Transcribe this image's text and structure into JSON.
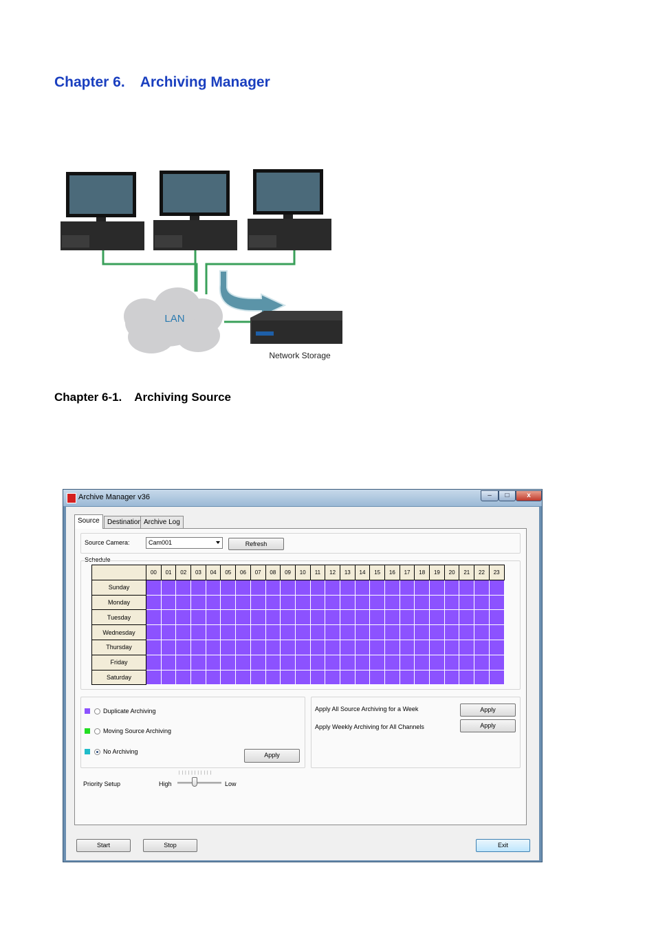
{
  "document": {
    "chapter_number": "Chapter 6.",
    "chapter_title": "Archiving Manager",
    "section_number": "Chapter 6-1.",
    "section_title": "Archiving Source"
  },
  "diagram": {
    "cloud_label": "LAN",
    "storage_label": "Network Storage",
    "colors": {
      "cable": "#3aa05a",
      "arrow": "#5b94a8",
      "cloud": "#cfcfd1"
    }
  },
  "window": {
    "title": "Archive Manager v36",
    "controls": {
      "minimize": "–",
      "maximize": "□",
      "close": "x"
    },
    "tabs": [
      "Source",
      "Destination",
      "Archive Log"
    ],
    "source_camera_label": "Source Camera:",
    "source_camera_value": "Cam001",
    "refresh_label": "Refresh",
    "schedule_label": "Schedule",
    "hours": [
      "00",
      "01",
      "02",
      "03",
      "04",
      "05",
      "06",
      "07",
      "08",
      "09",
      "10",
      "11",
      "12",
      "13",
      "14",
      "15",
      "16",
      "17",
      "18",
      "19",
      "20",
      "21",
      "22",
      "23"
    ],
    "days": [
      "Sunday",
      "Monday",
      "Tuesday",
      "Wednesday",
      "Thursday",
      "Friday",
      "Saturday"
    ],
    "options": [
      {
        "label": "Duplicate Archiving",
        "color": "#8c52ff",
        "selected": false
      },
      {
        "label": "Moving Source Archiving",
        "color": "#22dd22",
        "selected": false
      },
      {
        "label": "No Archiving",
        "color": "#1fbcc9",
        "selected": true
      }
    ],
    "apply_label": "Apply",
    "apply_week_label": "Apply All Source Archiving for a Week",
    "apply_week_button": "Apply",
    "apply_channels_label": "Apply Weekly Archiving for All Channels",
    "apply_channels_button": "Apply",
    "priority_label": "Priority Setup",
    "priority_high": "High",
    "priority_low": "Low",
    "start_label": "Start",
    "stop_label": "Stop",
    "exit_label": "Exit"
  }
}
